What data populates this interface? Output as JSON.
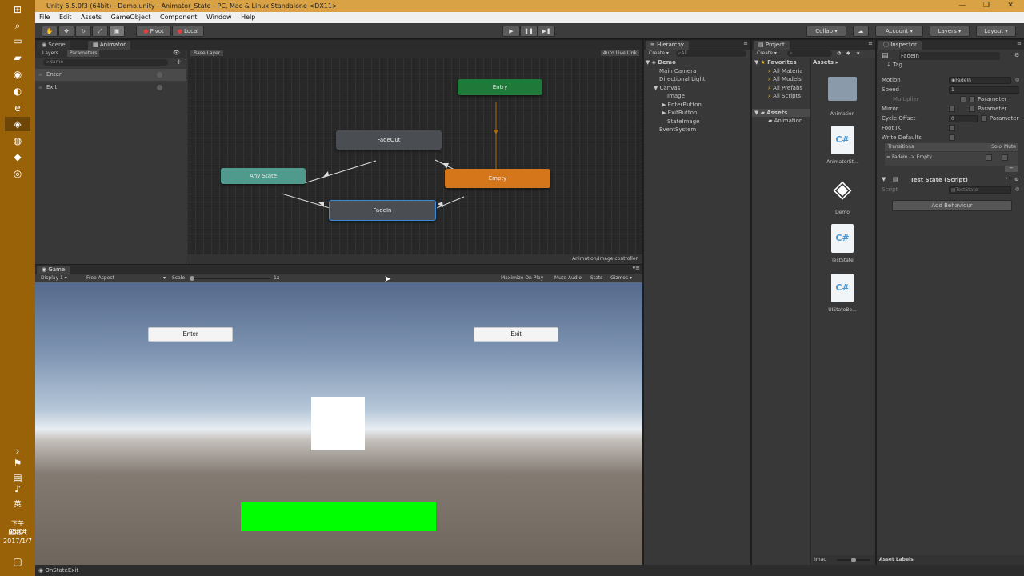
{
  "window": {
    "title": "Unity 5.5.0f3 (64bit) - Demo.unity - Animator_State - PC, Mac & Linux Standalone <DX11>"
  },
  "menu": [
    "File",
    "Edit",
    "Assets",
    "GameObject",
    "Component",
    "Window",
    "Help"
  ],
  "toolbar": {
    "pivot": "Pivot",
    "local": "Local",
    "collab": "Collab ▾",
    "account": "Account ▾",
    "layers": "Layers ▾",
    "layout": "Layout ▾"
  },
  "animator": {
    "tabs": [
      "Scene",
      "Animator"
    ],
    "subtabs": [
      "Layers",
      "Parameters"
    ],
    "search_placeholder": "Name",
    "params": [
      "Enter",
      "Exit"
    ],
    "base_layer": "Base Layer",
    "auto_live": "Auto Live Link",
    "footer_path": "Animation/Image.controller",
    "nodes": {
      "entry": "Entry",
      "fadeout": "FadeOut",
      "any_state": "Any State",
      "empty": "Empty",
      "fadein": "FadeIn"
    }
  },
  "game": {
    "tab": "Game",
    "display": "Display 1",
    "aspect": "Free Aspect",
    "scale_label": "Scale",
    "scale_value": "1x",
    "options": [
      "Maximize On Play",
      "Mute Audio",
      "Stats",
      "Gizmos ▾"
    ],
    "enter_button": "Enter",
    "exit_button": "Exit"
  },
  "hierarchy": {
    "tab": "Hierarchy",
    "create": "Create ▾",
    "search": "All",
    "scene": "Demo",
    "items": [
      "Main Camera",
      "Directional Light",
      "Canvas",
      "Image",
      "EnterButton",
      "ExitButton",
      "StateImage",
      "EventSystem"
    ]
  },
  "project": {
    "tab": "Project",
    "create": "Create ▾",
    "favorites": "Favorites",
    "fav_items": [
      "All Materia",
      "All Models",
      "All Prefabs",
      "All Scripts"
    ],
    "assets_root": "Assets",
    "asset_folders": [
      "Animation"
    ],
    "breadcrumb": "Assets ▸",
    "files": [
      "Animation",
      "AnimatorSt...",
      "Demo",
      "TestState",
      "UIStateBe..."
    ],
    "footer": "Imac"
  },
  "inspector": {
    "tab": "Inspector",
    "state_name": "FadeIn",
    "tag_label": "Tag",
    "fields": {
      "motion_label": "Motion",
      "motion_value": "FadeIn",
      "speed_label": "Speed",
      "speed_value": "1",
      "multiplier_label": "Multiplier",
      "mirror_label": "Mirror",
      "cycle_label": "Cycle Offset",
      "cycle_value": "0",
      "footik_label": "Foot IK",
      "write_label": "Write Defaults",
      "parameter": "Parameter"
    },
    "transitions_label": "Transitions",
    "solo": "Solo",
    "mute": "Mute",
    "transition_item": "FadeIn -> Empty",
    "script_component": "Test State (Script)",
    "script_label": "Script",
    "script_value": "TestState",
    "add_behaviour": "Add Behaviour",
    "asset_labels": "Asset Labels"
  },
  "status": {
    "message": "OnStateExit"
  },
  "taskbar": {
    "time": "下午 05:04",
    "weekday": "星期六",
    "date": "2017/1/7",
    "ime": "英"
  },
  "colors": {
    "entry_node": "#1f7a3a",
    "state_node": "#4a4d52",
    "any_state_node": "#4f9a8c",
    "default_state_node": "#d6761a",
    "green_bar": "#00ff00",
    "taskbar": "#9a6208",
    "titlebar": "#d9a245"
  }
}
